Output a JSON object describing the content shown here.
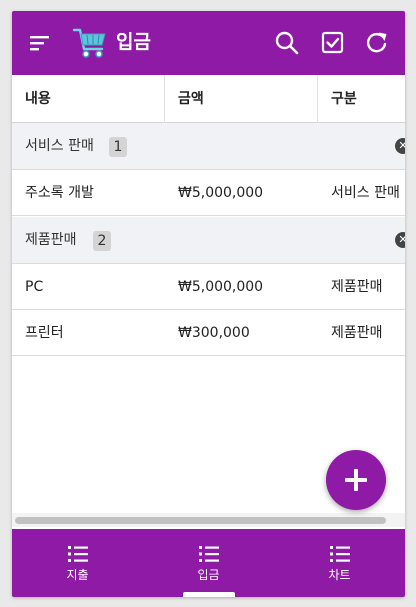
{
  "app": {
    "title": "입금",
    "accent_color": "#8e1aa5",
    "icons": [
      "menu-icon",
      "shopping-cart-icon",
      "search-icon",
      "checkbox-icon",
      "refresh-icon"
    ]
  },
  "table": {
    "columns": [
      "내용",
      "금액",
      "구분"
    ],
    "groups": [
      {
        "name": "서비스 판매",
        "count": "1",
        "rows": [
          [
            "주소록 개발",
            "₩5,000,000",
            "서비스 판매"
          ]
        ]
      },
      {
        "name": "제품판매",
        "count": "2",
        "rows": [
          [
            "PC",
            "₩5,000,000",
            "제품판매"
          ],
          [
            "프린터",
            "₩300,000",
            "제품판매"
          ]
        ]
      }
    ]
  },
  "bottom_nav": {
    "tabs": [
      {
        "label": "지출",
        "icon": "list-icon",
        "selected": false
      },
      {
        "label": "입금",
        "icon": "list-icon",
        "selected": true
      },
      {
        "label": "차트",
        "icon": "list-icon",
        "selected": false
      }
    ]
  },
  "fab": {
    "icon": "plus-icon"
  }
}
